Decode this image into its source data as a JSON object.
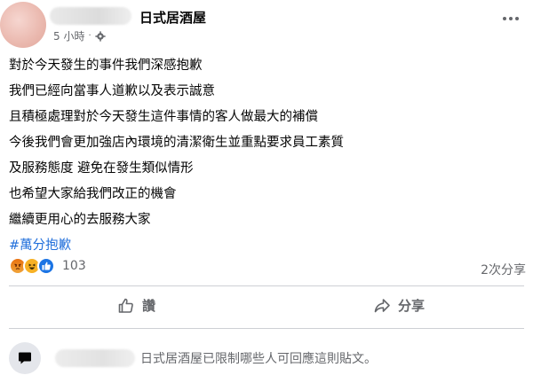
{
  "post": {
    "page_name": "日式居酒屋",
    "timestamp": "5 小時",
    "separator": "·",
    "lines": [
      "對於今天發生的事件我們深感抱歉",
      "我們已經向當事人道歉以及表示誠意",
      "且積極處理對於今天發生這件事情的客人做最大的補償",
      "今後我們會更加強店內環境的清潔衛生並重點要求員工素質",
      "及服務態度 避免在發生類似情形",
      "也希望大家給我們改正的機會",
      "繼續更用心的去服務大家"
    ],
    "hashtag": "#萬分抱歉"
  },
  "reactions": {
    "count": "103",
    "types": [
      "angry-icon",
      "haha-icon",
      "like-icon"
    ],
    "shares": "2次分享"
  },
  "actions": {
    "like_label": "讚",
    "share_label": "分享"
  },
  "comments": {
    "restricted_text": "日式居酒屋已限制哪些人可回應這則貼文。"
  },
  "colors": {
    "hashtag": "#216fdb",
    "secondary_text": "#65676b",
    "like_blue": "#1b74e4"
  }
}
